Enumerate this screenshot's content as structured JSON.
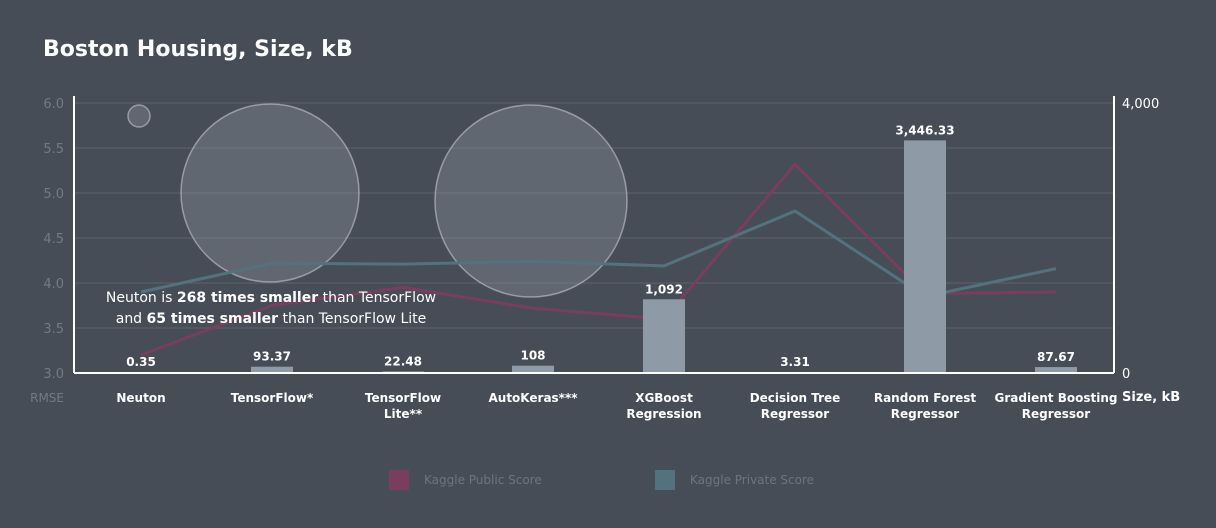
{
  "chart_data": {
    "type": "bar+line",
    "title": "Boston Housing, Size, kB",
    "categories": [
      [
        "Neuton"
      ],
      [
        "TensorFlow*"
      ],
      [
        "TensorFlow",
        "Lite**"
      ],
      [
        "AutoKeras***"
      ],
      [
        "XGBoost",
        "Regression"
      ],
      [
        "Decision Tree",
        "Regressor"
      ],
      [
        "Random Forest",
        "Regressor"
      ],
      [
        "Gradient Boosting",
        "Regressor"
      ]
    ],
    "bars": {
      "axis": "right",
      "values": [
        0.35,
        93.37,
        22.48,
        108,
        1092,
        3.31,
        3446.33,
        87.67
      ],
      "labels": [
        "0.35",
        "93.37",
        "22.48",
        "108",
        "1,092",
        "3.31",
        "3,446.33",
        "87.67"
      ],
      "color": "#8e9aa6"
    },
    "series": [
      {
        "name": "Kaggle Public Score",
        "axis": "left",
        "color": "#7a3d5e",
        "values": [
          3.2,
          3.75,
          3.95,
          3.72,
          3.6,
          5.32,
          3.88,
          3.9
        ]
      },
      {
        "name": "Kaggle  Private  Score",
        "axis": "left",
        "color": "#52737d",
        "values": [
          3.9,
          4.22,
          4.21,
          4.24,
          4.19,
          4.8,
          3.85,
          4.16
        ]
      }
    ],
    "y_left": {
      "label": "RMSE",
      "ylim": [
        3.0,
        6.0
      ],
      "ticks": [
        "3.0",
        "3.5",
        "4.0",
        "4.5",
        "5.0",
        "5.5",
        "6.0"
      ]
    },
    "y_right": {
      "label": "Size, kB",
      "ylim": [
        0,
        4000
      ],
      "ticks": [
        "0",
        "4,000"
      ]
    },
    "grid": true,
    "legend_position": "bottom-center"
  },
  "annotation": {
    "line1": [
      "Neuton is ",
      "268 times smaller",
      " than TensorFlow"
    ],
    "line2": [
      "and ",
      "65 times smaller",
      " than TensorFlow Lite"
    ]
  }
}
